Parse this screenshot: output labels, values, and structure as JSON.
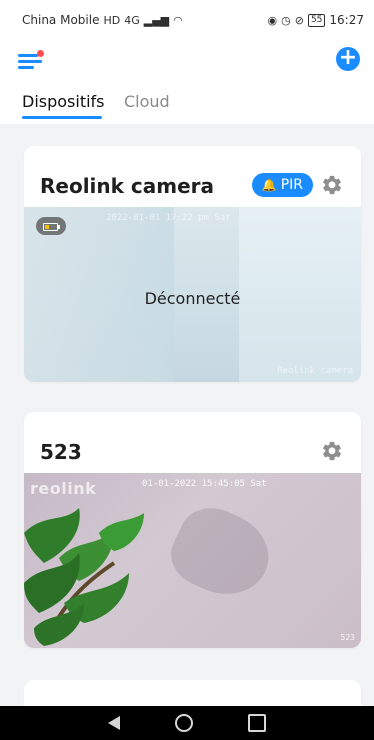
{
  "status_bar": {
    "carrier": "China Mobile",
    "network": "HD",
    "signal": "4G",
    "time": "16:27",
    "battery": "55"
  },
  "topbar": {
    "menu_icon": "menu-icon",
    "add_icon": "add-icon"
  },
  "tabs": [
    {
      "label": "Dispositifs"
    },
    {
      "label": "Cloud"
    }
  ],
  "cards": [
    {
      "title": "Reolink camera",
      "badge": "PIR",
      "status": "Déconnecté",
      "timestamp": "2022-01-01 17:22 pm Sat",
      "overlay_label": "Reolink camera"
    },
    {
      "title": "523",
      "logo": "reolink",
      "timestamp": "01-01-2022 15:45:05 Sat",
      "corner_label": "523"
    }
  ],
  "colors": {
    "accent": "#1a8cff",
    "menu_dot": "#ff4d4f",
    "card_bg": "#ffffff",
    "page_bg": "#f2f3f5"
  }
}
